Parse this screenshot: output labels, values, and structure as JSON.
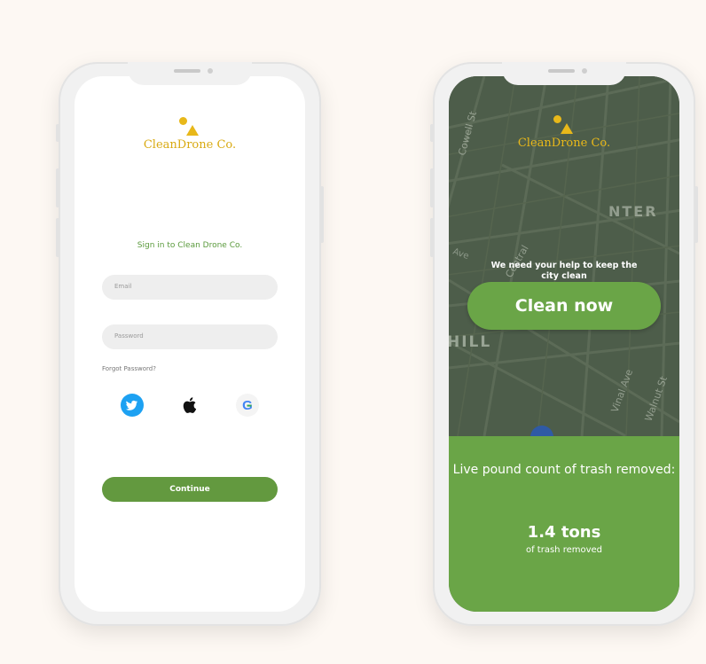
{
  "brand": {
    "name": "CleanDrone Co.",
    "color": "#e8b81a"
  },
  "login": {
    "title": "Sign in to Clean Drone Co.",
    "email_placeholder": "Email",
    "password_placeholder": "Password",
    "forgot_label": "Forgot Password?",
    "social": [
      "twitter-icon",
      "apple-icon",
      "google-icon"
    ],
    "google_letter": "G",
    "continue_label": "Continue",
    "accent": "#63993f"
  },
  "home": {
    "tagline": "We need your help to keep the city clean",
    "cta_label": "Clean now",
    "stats_label": "Live pound count of trash removed:",
    "stats_value": "1.4 tons",
    "stats_sub": "of trash removed",
    "map_labels": {
      "cowell": "Cowell St",
      "center": "NTER",
      "central": "Central",
      "hill": "HILL",
      "vinal": "Vinal Ave",
      "walnut": "Walnut St",
      "ave": "Ave"
    },
    "accent": "#6aa547",
    "map_color": "#4d5d4a"
  }
}
